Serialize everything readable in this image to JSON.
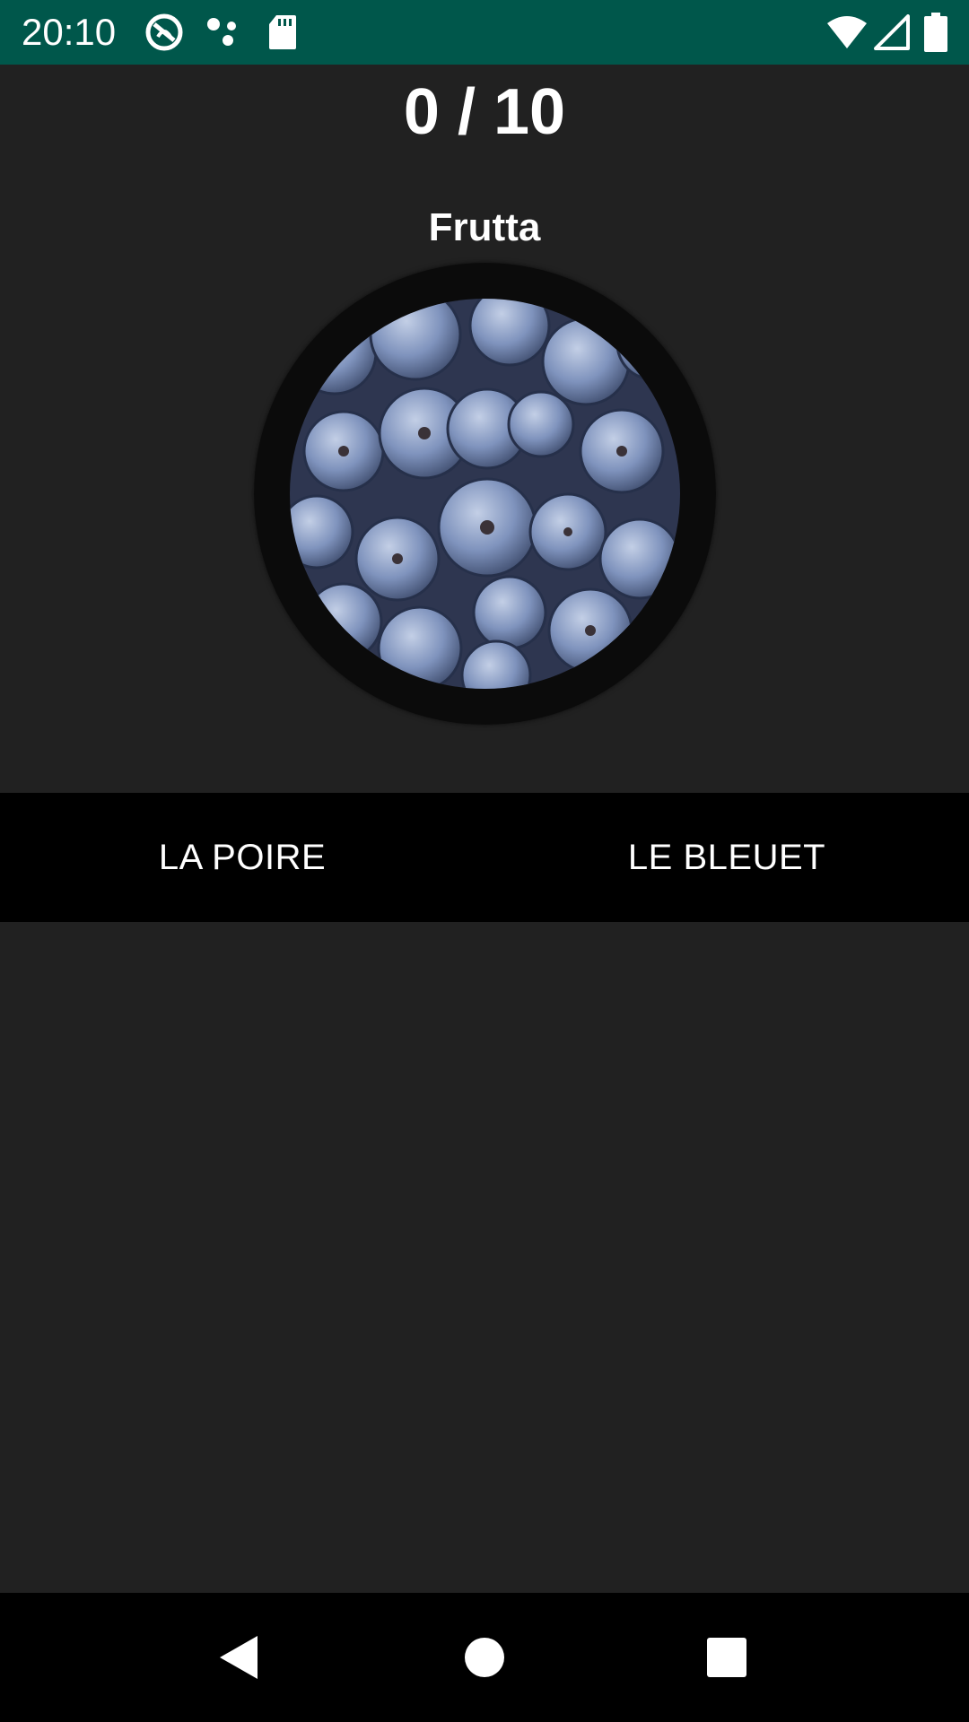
{
  "status_bar": {
    "time": "20:10",
    "background_color": "#00574b",
    "icons_left": [
      "accessibility-icon",
      "dots-icon",
      "sd-card-icon"
    ],
    "icons_right": [
      "wifi-icon",
      "signal-icon",
      "battery-icon"
    ]
  },
  "quiz": {
    "score": "0 / 10",
    "category": "Frutta",
    "image": "blueberries-picture"
  },
  "answers": {
    "option_1": "LA POIRE",
    "option_2": "LE BLEUET"
  },
  "colors": {
    "background": "#212121",
    "bar": "#000000",
    "text": "#ffffff"
  },
  "nav_bar": {
    "icons": [
      "back-icon",
      "home-icon",
      "recents-icon"
    ]
  }
}
